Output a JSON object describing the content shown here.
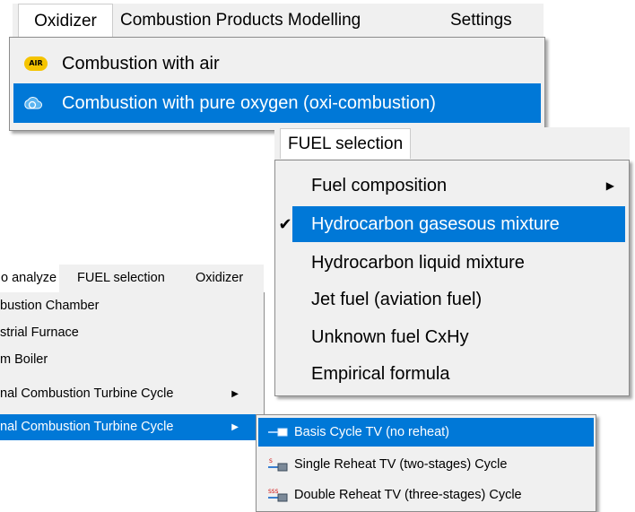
{
  "oxidizer_menu": {
    "menubar": [
      "Oxidizer",
      "Combustion Products Modelling",
      "Settings"
    ],
    "items": [
      {
        "label": "Combustion with air",
        "icon": "air-icon",
        "highlighted": false
      },
      {
        "label": "Combustion with pure oxygen (oxi-combustion)",
        "icon": "oxygen-icon",
        "highlighted": true
      }
    ],
    "air_icon_text": "AIR"
  },
  "fuel_menu": {
    "menubar": [
      "FUEL selection"
    ],
    "items": [
      {
        "label": "Fuel composition",
        "checked": false,
        "submenu": true,
        "highlighted": false
      },
      {
        "label": "Hydrocarbon gasesous mixture",
        "checked": true,
        "submenu": false,
        "highlighted": true
      },
      {
        "label": "Hydrocarbon liquid mixture",
        "checked": false,
        "submenu": false,
        "highlighted": false
      },
      {
        "label": "Jet fuel (aviation fuel)",
        "checked": false,
        "submenu": false,
        "highlighted": false
      },
      {
        "label": "Unknown fuel CxHy",
        "checked": false,
        "submenu": false,
        "highlighted": false
      },
      {
        "label": "Empirical formula",
        "checked": false,
        "submenu": false,
        "highlighted": false
      }
    ]
  },
  "cycle_menu": {
    "menubar": [
      "o analyze",
      "FUEL selection",
      "Oxidizer"
    ],
    "items": [
      {
        "label": "bustion Chamber",
        "submenu": false,
        "highlighted": false
      },
      {
        "label": "strial Furnace",
        "submenu": false,
        "highlighted": false
      },
      {
        "label": "m Boiler",
        "submenu": false,
        "highlighted": false
      },
      {
        "label": "nal Combustion Turbine Cycle",
        "submenu": true,
        "highlighted": false
      },
      {
        "label": "nal Combustion Turbine Cycle",
        "submenu": true,
        "highlighted": true
      }
    ],
    "submenu_items": [
      {
        "label": "Basis Cycle TV (no reheat)",
        "icon": "turbine-icon",
        "highlighted": true
      },
      {
        "label": "Single Reheat TV (two-stages) Cycle",
        "icon": "turbine-s-icon",
        "highlighted": false
      },
      {
        "label": "Double Reheat TV (three-stages) Cycle",
        "icon": "turbine-sss-icon",
        "highlighted": false
      }
    ]
  },
  "colors": {
    "highlight": "#0078d7",
    "menu_bg": "#f0f0f0",
    "air_icon": "#f5c400"
  }
}
